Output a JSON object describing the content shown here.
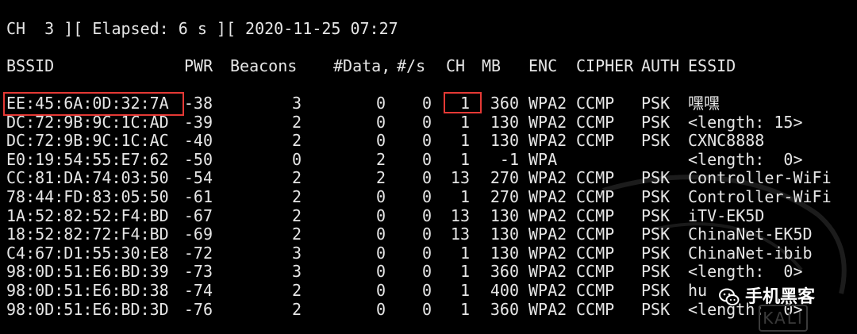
{
  "status": {
    "text": "CH  3 ][ Elapsed: 6 s ][ 2020-11-25 07:27"
  },
  "headers": {
    "bssid": "BSSID",
    "pwr": "PWR",
    "beacons": "Beacons",
    "data": "#Data,",
    "rate": "#/s",
    "ch": "CH",
    "mb": "MB",
    "enc": "ENC",
    "cipher": "CIPHER",
    "auth": "AUTH",
    "essid": "ESSID"
  },
  "rows": [
    {
      "bssid": "EE:45:6A:0D:32:7A",
      "pwr": "-38",
      "beacons": "3",
      "data": "0",
      "rate": "0",
      "ch": "1",
      "mb": "360",
      "enc": "WPA2",
      "cipher": "CCMP",
      "auth": "PSK",
      "essid": "嘿嘿"
    },
    {
      "bssid": "DC:72:9B:9C:1C:AD",
      "pwr": "-39",
      "beacons": "2",
      "data": "0",
      "rate": "0",
      "ch": "1",
      "mb": "130",
      "enc": "WPA2",
      "cipher": "CCMP",
      "auth": "PSK",
      "essid": "<length: 15>"
    },
    {
      "bssid": "DC:72:9B:9C:1C:AC",
      "pwr": "-40",
      "beacons": "2",
      "data": "0",
      "rate": "0",
      "ch": "1",
      "mb": "130",
      "enc": "WPA2",
      "cipher": "CCMP",
      "auth": "PSK",
      "essid": "CXNC8888"
    },
    {
      "bssid": "E0:19:54:55:E7:62",
      "pwr": "-50",
      "beacons": "0",
      "data": "2",
      "rate": "0",
      "ch": "1",
      "mb": "-1",
      "enc": "WPA",
      "cipher": "",
      "auth": "",
      "essid": "<length:  0>"
    },
    {
      "bssid": "CC:81:DA:74:03:50",
      "pwr": "-54",
      "beacons": "2",
      "data": "2",
      "rate": "0",
      "ch": "13",
      "mb": "270",
      "enc": "WPA2",
      "cipher": "CCMP",
      "auth": "PSK",
      "essid": "Controller-WiFi"
    },
    {
      "bssid": "78:44:FD:83:05:50",
      "pwr": "-61",
      "beacons": "2",
      "data": "0",
      "rate": "0",
      "ch": "1",
      "mb": "270",
      "enc": "WPA2",
      "cipher": "CCMP",
      "auth": "PSK",
      "essid": "Controller-WiFi"
    },
    {
      "bssid": "1A:52:82:52:F4:BD",
      "pwr": "-67",
      "beacons": "2",
      "data": "0",
      "rate": "0",
      "ch": "13",
      "mb": "130",
      "enc": "WPA2",
      "cipher": "CCMP",
      "auth": "PSK",
      "essid": "iTV-EK5D"
    },
    {
      "bssid": "18:52:82:72:F4:BD",
      "pwr": "-69",
      "beacons": "2",
      "data": "0",
      "rate": "0",
      "ch": "13",
      "mb": "130",
      "enc": "WPA2",
      "cipher": "CCMP",
      "auth": "PSK",
      "essid": "ChinaNet-EK5D"
    },
    {
      "bssid": "C4:67:D1:55:30:E8",
      "pwr": "-72",
      "beacons": "3",
      "data": "0",
      "rate": "0",
      "ch": "1",
      "mb": "130",
      "enc": "WPA2",
      "cipher": "CCMP",
      "auth": "PSK",
      "essid": "ChinaNet-ibib"
    },
    {
      "bssid": "98:0D:51:E6:BD:39",
      "pwr": "-73",
      "beacons": "3",
      "data": "0",
      "rate": "0",
      "ch": "1",
      "mb": "360",
      "enc": "WPA2",
      "cipher": "CCMP",
      "auth": "PSK",
      "essid": "<length:  0>"
    },
    {
      "bssid": "98:0D:51:E6:BD:38",
      "pwr": "-74",
      "beacons": "2",
      "data": "0",
      "rate": "0",
      "ch": "1",
      "mb": "400",
      "enc": "WPA2",
      "cipher": "CCMP",
      "auth": "PSK",
      "essid": "hu"
    },
    {
      "bssid": "98:0D:51:E6:BD:3D",
      "pwr": "-76",
      "beacons": "2",
      "data": "0",
      "rate": "0",
      "ch": "1",
      "mb": "360",
      "enc": "WPA2",
      "cipher": "CCMP",
      "auth": "PSK",
      "essid": "<length:  0>"
    }
  ],
  "watermark": {
    "text": "手机黑客",
    "icon": "wechat-icon"
  },
  "kali_logo": {
    "text": "KALI"
  },
  "colors": {
    "background": "#000000",
    "text": "#e6e6e6",
    "highlight": "#e53935"
  }
}
